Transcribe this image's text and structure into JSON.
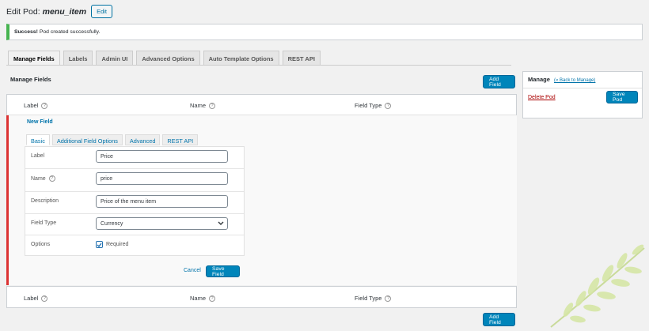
{
  "header": {
    "title_prefix": "Edit Pod:",
    "pod_name": "menu_item",
    "edit_label": "Edit"
  },
  "notice": {
    "strong": "Success!",
    "text": "Pod created successfully."
  },
  "nav_tabs": [
    "Manage Fields",
    "Labels",
    "Admin UI",
    "Advanced Options",
    "Auto Template Options",
    "REST API"
  ],
  "section_title": "Manage Fields",
  "add_field_label": "Add Field",
  "table": {
    "columns": [
      "Label",
      "Name",
      "Field Type"
    ]
  },
  "new_field": {
    "title": "New Field",
    "tabs": [
      "Basic",
      "Additional Field Options",
      "Advanced",
      "REST API"
    ],
    "rows": {
      "label": {
        "label": "Label",
        "value": "Price"
      },
      "name": {
        "label": "Name",
        "value": "price"
      },
      "description": {
        "label": "Description",
        "value": "Price of the menu item"
      },
      "field_type": {
        "label": "Field Type",
        "value": "Currency"
      },
      "options": {
        "label": "Options",
        "checkbox": "Required"
      }
    },
    "cancel_label": "Cancel",
    "save_label": "Save Field"
  },
  "manage_box": {
    "title": "Manage",
    "back_link": "« Back to Manage",
    "delete_label": "Delete Pod",
    "save_label": "Save Pod"
  },
  "icons": {
    "help": "help-icon",
    "check": "check-icon",
    "chevron": "chevron-down-icon",
    "leaf": "leaf-decoration"
  },
  "colors": {
    "primary": "#0085ba",
    "link": "#0073aa",
    "success": "#46b450",
    "danger_border": "#dc3232",
    "delete": "#aa0000"
  }
}
